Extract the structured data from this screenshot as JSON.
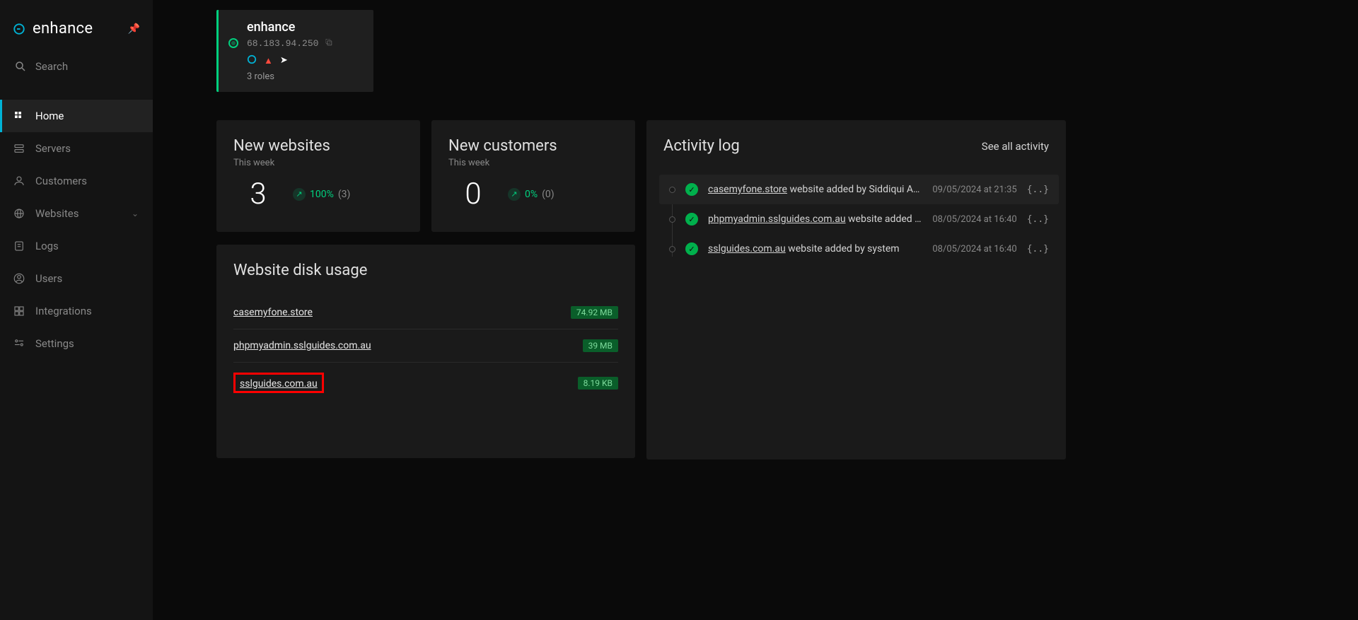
{
  "brand": {
    "name": "enhance"
  },
  "search": {
    "label": "Search"
  },
  "nav": {
    "items": [
      {
        "label": "Home",
        "active": true
      },
      {
        "label": "Servers"
      },
      {
        "label": "Customers"
      },
      {
        "label": "Websites",
        "expandable": true
      },
      {
        "label": "Logs"
      },
      {
        "label": "Users"
      },
      {
        "label": "Integrations"
      },
      {
        "label": "Settings"
      }
    ]
  },
  "server": {
    "name": "enhance",
    "ip": "68.183.94.250",
    "roles_text": "3 roles"
  },
  "stats": {
    "websites": {
      "title": "New websites",
      "subtitle": "This week",
      "value": "3",
      "pct": "100%",
      "extra": "(3)"
    },
    "customers": {
      "title": "New customers",
      "subtitle": "This week",
      "value": "0",
      "pct": "0%",
      "extra": "(0)"
    }
  },
  "disk": {
    "title": "Website disk usage",
    "items": [
      {
        "site": "casemyfone.store",
        "size": "74.92 MB",
        "highlight": false
      },
      {
        "site": "phpmyadmin.sslguides.com.au",
        "size": "39 MB",
        "highlight": false
      },
      {
        "site": "sslguides.com.au",
        "size": "8.19 KB",
        "highlight": true
      }
    ]
  },
  "activity": {
    "title": "Activity log",
    "see_all": "See all activity",
    "json_label": "{..}",
    "items": [
      {
        "site": "casemyfone.store",
        "suffix": " website added by Siddiqui Amm...",
        "time": "09/05/2024 at 21:35"
      },
      {
        "site": "phpmyadmin.sslguides.com.au",
        "suffix": " website added by ...",
        "time": "08/05/2024 at 16:40"
      },
      {
        "site": "sslguides.com.au",
        "suffix": " website added by system",
        "time": "08/05/2024 at 16:40"
      }
    ]
  }
}
